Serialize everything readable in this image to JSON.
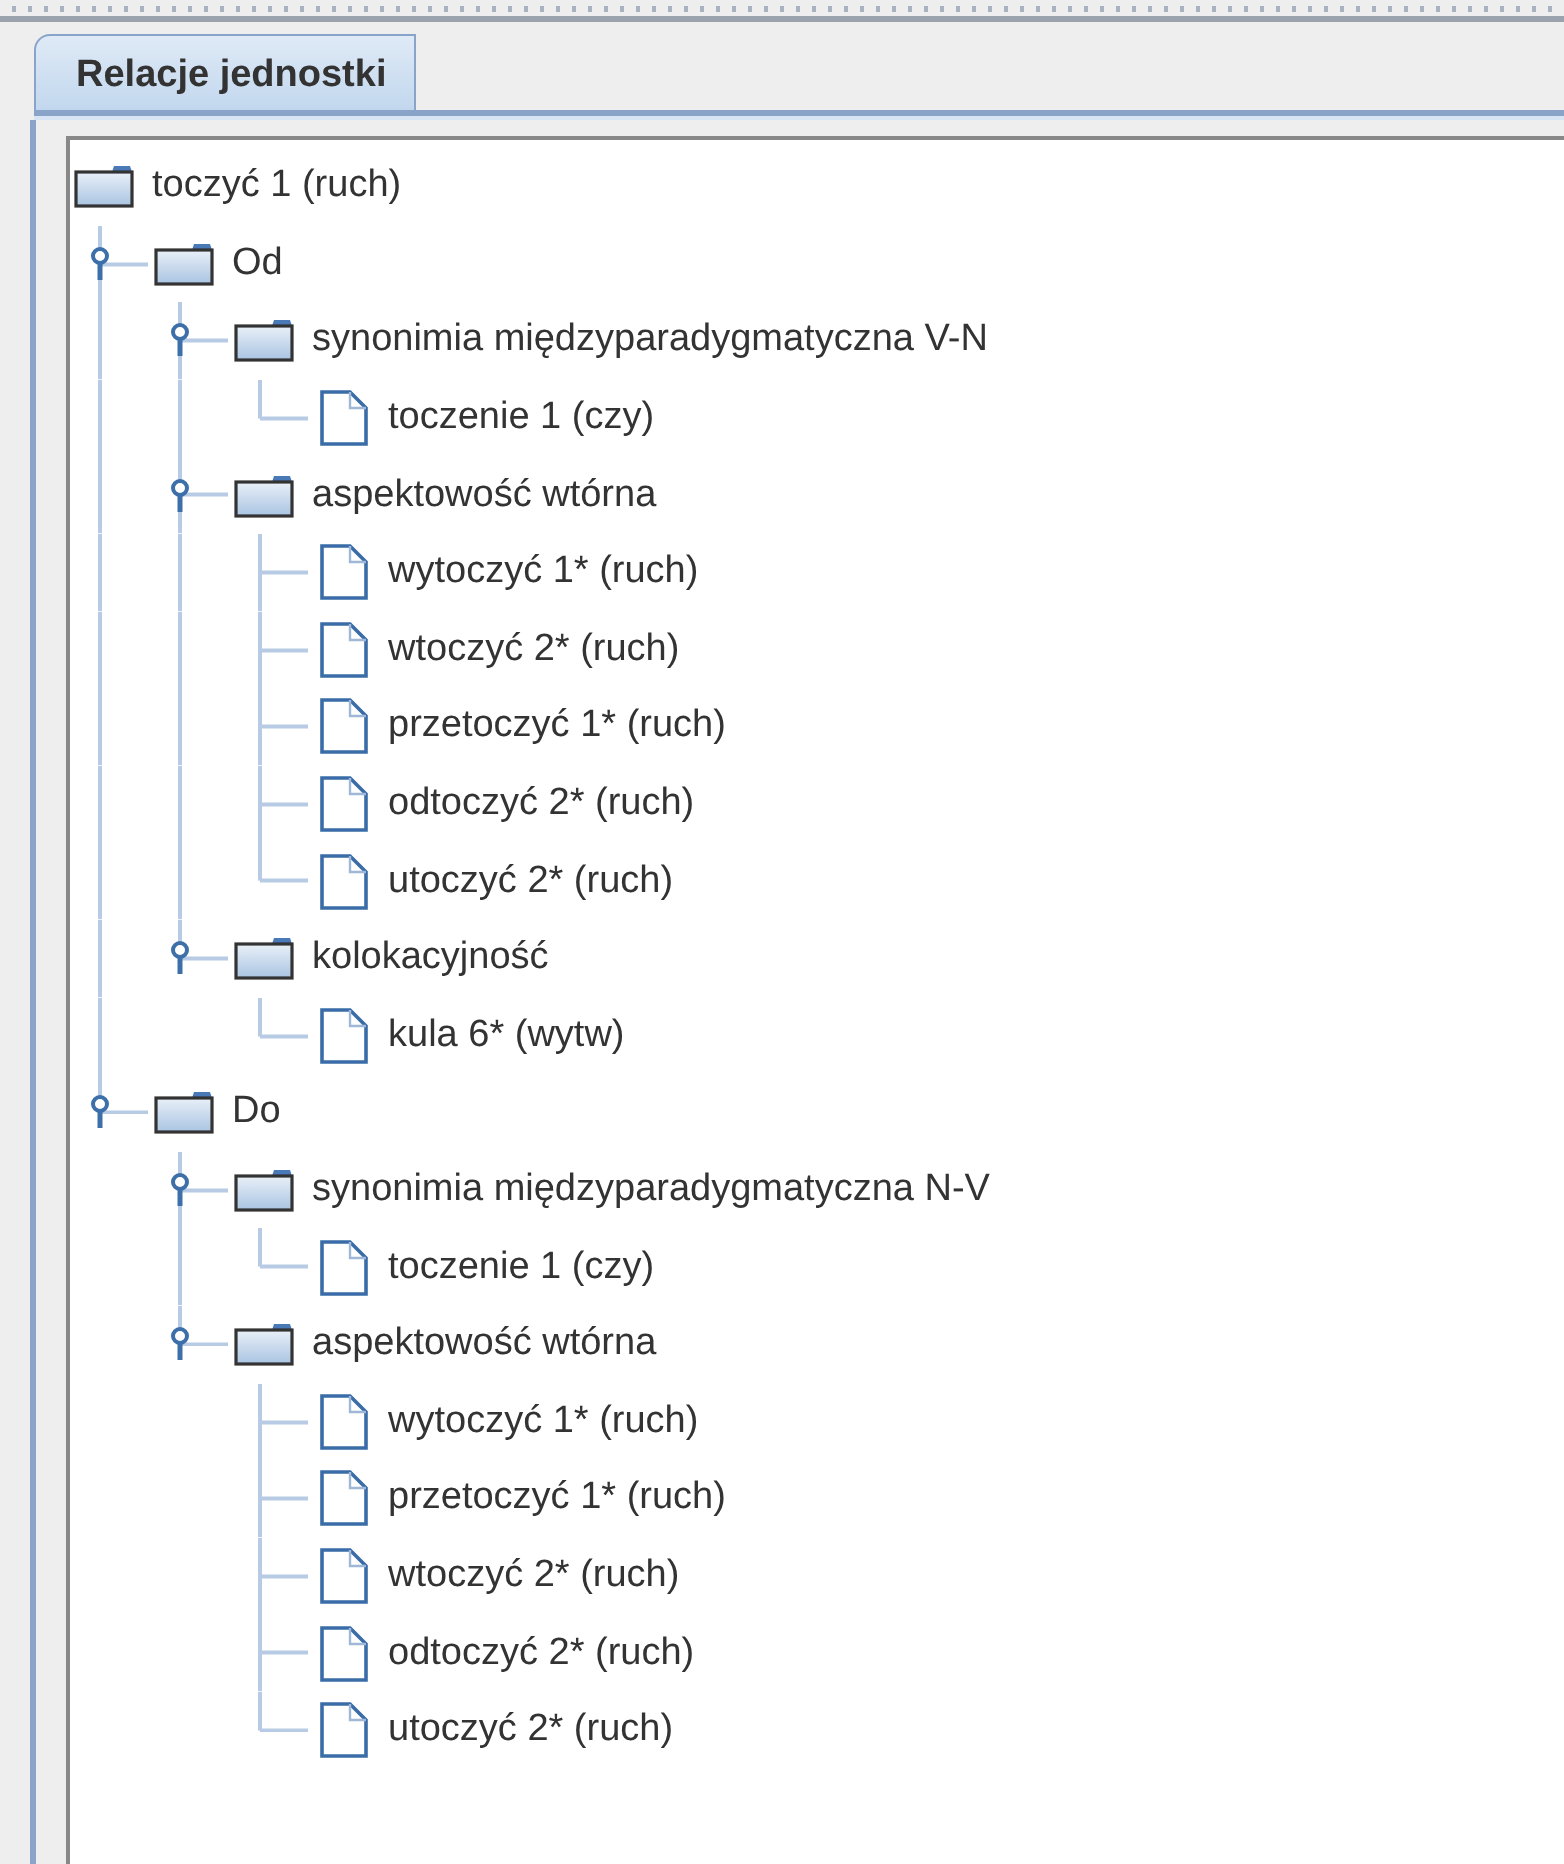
{
  "tab": {
    "label": "Relacje jednostki",
    "selected": true
  },
  "tree": {
    "label": "toczyć 1 (ruch)",
    "kind": "folder",
    "children": [
      {
        "label": "Od",
        "kind": "folder",
        "expanded": true,
        "children": [
          {
            "label": "synonimia międzyparadygmatyczna V-N",
            "kind": "folder",
            "expanded": true,
            "children": [
              {
                "label": "toczenie 1 (czy)",
                "kind": "leaf"
              }
            ]
          },
          {
            "label": "aspektowość wtórna",
            "kind": "folder",
            "expanded": true,
            "children": [
              {
                "label": "wytoczyć 1* (ruch)",
                "kind": "leaf"
              },
              {
                "label": "wtoczyć 2* (ruch)",
                "kind": "leaf"
              },
              {
                "label": "przetoczyć 1* (ruch)",
                "kind": "leaf"
              },
              {
                "label": "odtoczyć 2* (ruch)",
                "kind": "leaf"
              },
              {
                "label": "utoczyć 2* (ruch)",
                "kind": "leaf"
              }
            ]
          },
          {
            "label": "kolokacyjność",
            "kind": "folder",
            "expanded": true,
            "children": [
              {
                "label": "kula 6* (wytw)",
                "kind": "leaf"
              }
            ]
          }
        ]
      },
      {
        "label": "Do",
        "kind": "folder",
        "expanded": true,
        "children": [
          {
            "label": "synonimia międzyparadygmatyczna N-V",
            "kind": "folder",
            "expanded": true,
            "children": [
              {
                "label": "toczenie 1 (czy)",
                "kind": "leaf"
              }
            ]
          },
          {
            "label": "aspektowość wtórna",
            "kind": "folder",
            "expanded": true,
            "children": [
              {
                "label": "wytoczyć 1* (ruch)",
                "kind": "leaf"
              },
              {
                "label": "przetoczyć 1* (ruch)",
                "kind": "leaf"
              },
              {
                "label": "wtoczyć 2* (ruch)",
                "kind": "leaf"
              },
              {
                "label": "odtoczyć 2* (ruch)",
                "kind": "leaf"
              },
              {
                "label": "utoczyć 2* (ruch)",
                "kind": "leaf"
              }
            ]
          }
        ]
      }
    ]
  }
}
